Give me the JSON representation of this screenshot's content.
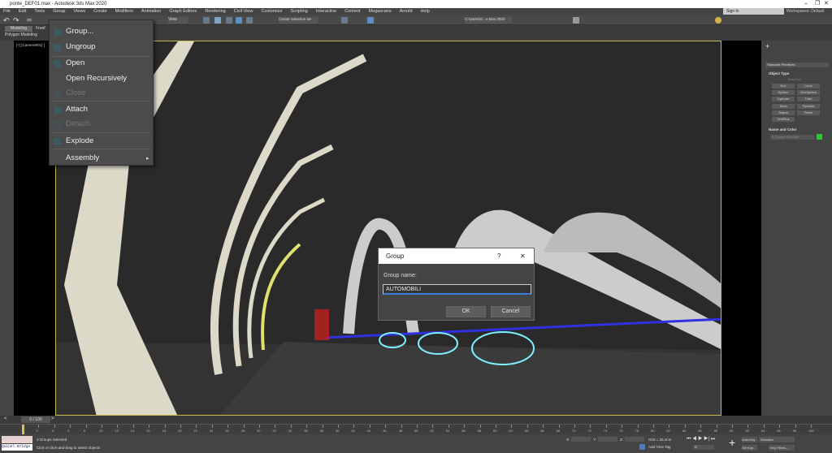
{
  "window": {
    "title": "ponte_DEF01.max - Autodesk 3ds Max 2020"
  },
  "menubar": [
    "File",
    "Edit",
    "Tools",
    "Group",
    "Views",
    "Create",
    "Modifiers",
    "Animation",
    "Graph Editors",
    "Rendering",
    "Civil View",
    "Customize",
    "Scripting",
    "Interactive",
    "Content",
    "Megascans",
    "Arnold",
    "Help"
  ],
  "account": {
    "signin": "Sign In",
    "workspace": "Workspaces: Default"
  },
  "toolbar": {
    "view_dropdown": "View",
    "selection_set": "Create Selection Se",
    "project_path": "C:\\Users\\G...s Max 2020"
  },
  "ribbon": {
    "tabs": [
      "Modeling",
      "Freef"
    ],
    "sub": "Polygon Modeling"
  },
  "viewport": {
    "label": "[+] [Camera001] [",
    "colors": {
      "border": "#c8b94a",
      "selection": "#7ff0ff"
    }
  },
  "group_menu": {
    "items": [
      {
        "label": "Group...",
        "enabled": true
      },
      {
        "label": "Ungroup",
        "enabled": true
      },
      {
        "label": "Open",
        "enabled": true
      },
      {
        "label": "Open Recursively",
        "enabled": true
      },
      {
        "label": "Close",
        "enabled": false
      },
      {
        "label": "Attach",
        "enabled": true
      },
      {
        "label": "Detach",
        "enabled": false
      },
      {
        "label": "Explode",
        "enabled": true
      },
      {
        "label": "Assembly",
        "enabled": true,
        "submenu": true
      }
    ]
  },
  "dialog": {
    "title": "Group",
    "help": "?",
    "close": "✕",
    "field_label": "Group name:",
    "field_value": "AUTOMOBILI",
    "ok": "OK",
    "cancel": "Cancel"
  },
  "command_panel": {
    "dropdown": "Standard Primitives",
    "rollout_object_type": "Object Type",
    "autogrid": "AutoGrid",
    "buttons": [
      "Box",
      "Cone",
      "Sphere",
      "GeoSphere",
      "Cylinder",
      "Tube",
      "Torus",
      "Pyramid",
      "Teapot",
      "Plane",
      "TextPlus"
    ],
    "rollout_name": "Name and Color",
    "name_value": "3 Groups Selected",
    "color": "#22cc22"
  },
  "timeline": {
    "frame": "0 / 100",
    "ticks": [
      "0",
      "2",
      "4",
      "6",
      "8",
      "10",
      "12",
      "14",
      "16",
      "18",
      "20",
      "22",
      "24",
      "26",
      "28",
      "30",
      "32",
      "34",
      "36",
      "38",
      "40",
      "42",
      "44",
      "46",
      "48",
      "50",
      "52",
      "54",
      "56",
      "58",
      "60",
      "62",
      "64",
      "66",
      "68",
      "70",
      "72",
      "74",
      "76",
      "78",
      "80",
      "82",
      "84",
      "86",
      "88",
      "90",
      "92",
      "94",
      "96",
      "98",
      "100"
    ]
  },
  "status": {
    "script": "Quinel Bridge",
    "selection": "3 Groups Selected",
    "prompt": "Click or click-and-drag to select objects",
    "x_label": "X:",
    "y_label": "Y:",
    "z_label": "Z:",
    "grid": "Grid = 25,4cm",
    "time_tag": "Add Time Tag",
    "auto_key": "Auto Key",
    "set_key": "Set Key",
    "key_mode": "Selected",
    "key_filters": "Key Filters...",
    "frame_field": "0"
  }
}
